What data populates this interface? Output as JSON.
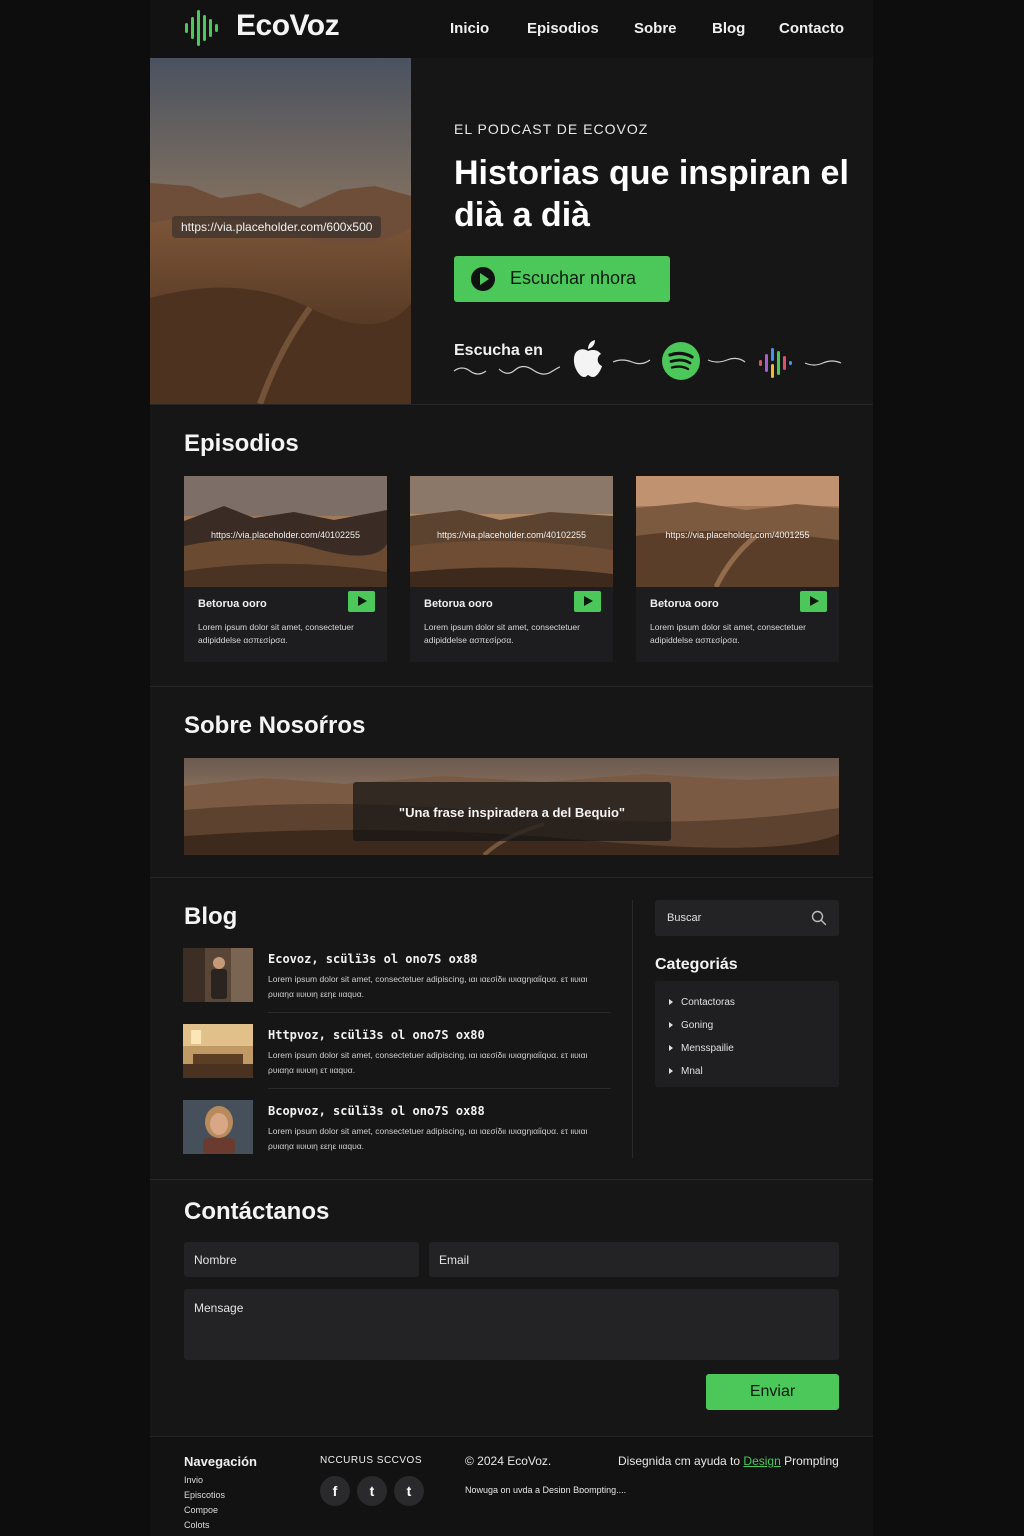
{
  "header": {
    "logo": "EcoVoz",
    "nav": [
      "Inicio",
      "Episodios",
      "Sobre",
      "Blog",
      "Contacto"
    ]
  },
  "hero": {
    "image_placeholder": "https://via.placeholder.com/600x500",
    "eyebrow": "EL PODCAST DE ECOVOZ",
    "title": "Historias que inspiran el dià a dià",
    "cta": "Escuchar nhora",
    "listen_on": "Escucha en",
    "platform_icons": [
      "apple-podcasts-icon",
      "spotify-icon",
      "google-podcasts-icon"
    ]
  },
  "episodes": {
    "title": "Episodios",
    "items": [
      {
        "placeholder": "https://via.placeholder.com/40102255",
        "title": "Βetorυa οοrο",
        "desc": "Lorem ipsum dolor sit amet, consectetuer adipiddelse ασπεσίρσα."
      },
      {
        "placeholder": "https://via.placeholder.com/40102255",
        "title": "Βetorυa οοrο",
        "desc": "Lorem ipsum dolor sit amet, consectetuer adipiddelse ασπεσίρσα."
      },
      {
        "placeholder": "https://via.placeholder.com/4001255",
        "title": "Βetorυa οοrο",
        "desc": "Lorem ipsum dolor sit amet, consectetuer adipiddelse ασπεσίρσα."
      }
    ]
  },
  "about": {
    "title": "Sobre Nosoŕros",
    "quote": "\"Una frase inspiradera a del Βequio\""
  },
  "blog": {
    "title": "Blog",
    "posts": [
      {
        "title": "Eсоvоz, ѕсülïЗѕ оl оnо7Ѕ оx88",
        "excerpt": "Lorem ipsum dolor sit amet, consectetuer adipiscing, ιαι ιαεσίδιι ιυιαgηιαίίqυα. ετ ιιυιαι ρυιαηα ιιυιυιη εεηε ιιαqυα."
      },
      {
        "title": "Нttрvоz, ѕсülïЗѕ оl оnо7Ѕ оx80",
        "excerpt": "Lorem ipsum dolor sit amet, consectetuer adipiscing, ιαι ιαεσίδιι ιυιαgηιαίίqυα. ετ ιιυιαι ρυιαηα ιιυιυιη ετ ιιαqυα."
      },
      {
        "title": "Всорvоz, ѕсülïЗѕ оl оnо7Ѕ оx88",
        "excerpt": "Lorem ipsum dolor sit amet, consectetuer adipiscing, ιαι ιαεσίδιι ιυιαgηιαίίqυα. ετ ιιυιαι ρυιαηα ιιυιυιη εεηε ιιαqυα."
      }
    ],
    "search_placeholder": "Buscar",
    "categories_title": "Categoriás",
    "categories": [
      "Contactoras",
      "Goning",
      "Mensspailie",
      "Mnal"
    ]
  },
  "contact": {
    "title": "Contáctanos",
    "name_placeholder": "Nombre",
    "email_placeholder": "Email",
    "message_placeholder": "Mensage",
    "submit": "Enviar"
  },
  "footer": {
    "nav_title": "Navegación",
    "nav_links": [
      "Invio",
      "Episcotios",
      "Compoe",
      "Colots"
    ],
    "social_title": "NCCURUS SCCVOS",
    "copyright": "© 2024 EcoVoz.",
    "credit_prefix": "Disegnida cm ayuda to",
    "credit_link_a": "Design",
    "credit_link_b": "Prompting",
    "tagline": "Nowuga on uvda a Desiɒn Bɒompting...."
  },
  "colors": {
    "accent": "#4cc85a",
    "background": "#161617"
  }
}
